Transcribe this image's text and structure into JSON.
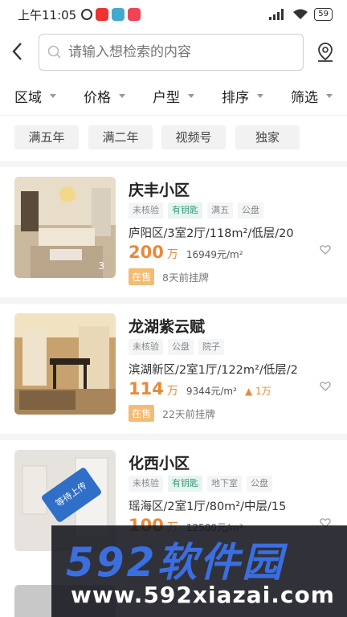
{
  "status_bar": {
    "time": "上午11:05",
    "battery": "59"
  },
  "search": {
    "placeholder": "请输入想检索的内容"
  },
  "filters": [
    "区域",
    "价格",
    "户型",
    "排序",
    "筛选"
  ],
  "quick_tags": [
    "满五年",
    "满二年",
    "视频号",
    "独家"
  ],
  "listings": [
    {
      "name": "庆丰小区",
      "chips": [
        {
          "label": "未核验",
          "style": "gray"
        },
        {
          "label": "有钥匙",
          "style": "green"
        },
        {
          "label": "满五",
          "style": "gray"
        },
        {
          "label": "公盘",
          "style": "gray"
        }
      ],
      "info": "庐阳区/3室2厅/118m²/低层/20",
      "price": "200",
      "price_unit": "万",
      "unit_price": "16949元/m²",
      "change": "",
      "status": "在售",
      "listed": "8天前挂牌",
      "photo_count": "3"
    },
    {
      "name": "龙湖紫云赋",
      "chips": [
        {
          "label": "未核验",
          "style": "gray"
        },
        {
          "label": "公盘",
          "style": "gray"
        },
        {
          "label": "院子",
          "style": "gray"
        }
      ],
      "info": "滨湖新区/2室1厅/122m²/低层/2",
      "price": "114",
      "price_unit": "万",
      "unit_price": "9344元/m²",
      "change": "▲ 1万",
      "status": "在售",
      "listed": "22天前挂牌",
      "photo_count": ""
    },
    {
      "name": "化西小区",
      "chips": [
        {
          "label": "未核验",
          "style": "gray"
        },
        {
          "label": "有钥匙",
          "style": "green"
        },
        {
          "label": "地下室",
          "style": "gray"
        },
        {
          "label": "公盘",
          "style": "gray"
        }
      ],
      "info": "瑶海区/2室1厅/80m²/中层/15",
      "price": "100",
      "price_unit": "万",
      "unit_price": "12500元/m²",
      "change": "",
      "status": "",
      "listed": "",
      "photo_count": "",
      "image_badge": "等待上传"
    }
  ],
  "watermark": {
    "brand": "592软件园",
    "url": "www.592xiazai.com"
  }
}
